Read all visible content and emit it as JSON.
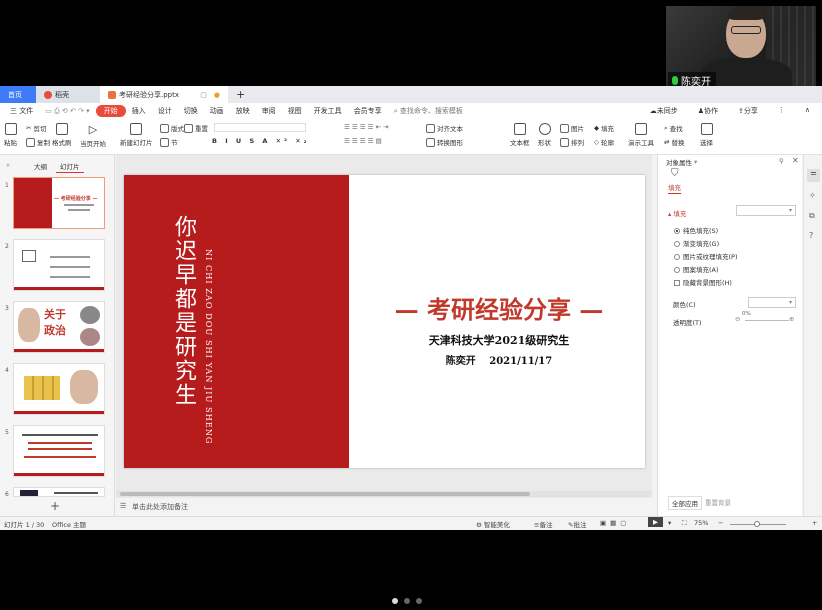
{
  "video": {
    "participant_name": "陈奕开"
  },
  "tabs": [
    {
      "label": "首页"
    },
    {
      "label": "稻壳"
    },
    {
      "label": "考研经验分享.pptx"
    }
  ],
  "menu": {
    "file": "三 文件",
    "items": [
      "开始",
      "插入",
      "设计",
      "切换",
      "动画",
      "放映",
      "审阅",
      "视图",
      "开发工具",
      "会员专享"
    ],
    "search_placeholder": "查找命令、搜索模板",
    "right": [
      "未同步",
      "协作",
      "分享"
    ]
  },
  "ribbon": {
    "paste": "粘贴",
    "cut": "剪切",
    "copy": "复制",
    "format_painter": "格式刷",
    "from_current": "当页开始",
    "new_slide": "新建幻灯片",
    "layout": "版式",
    "section": "节",
    "reset": "重置",
    "align_text": "对齐文本",
    "convert_smartart": "转换图形",
    "textbox": "文本框",
    "shape": "形状",
    "arrange": "排列",
    "picture": "图片",
    "fill": "填充",
    "outline": "轮廓",
    "presenter_tools": "演示工具",
    "find": "查找",
    "replace": "替换",
    "select": "选择"
  },
  "left_pane": {
    "tabs": [
      "大纲",
      "幻灯片"
    ],
    "slide_numbers": [
      "1",
      "2",
      "3",
      "4",
      "5",
      "6"
    ],
    "thumb3_title": "关于",
    "thumb3_sub": "政治",
    "thumb1_title": "— 考研经验分享 —"
  },
  "slide": {
    "vertical_title": "你迟早都是研究生",
    "vertical_pinyin": "NI CHI ZAO DOU SHI YAN JIU SHENG",
    "title": "— 考研经验分享 —",
    "subtitle": "天津科技大学2021级研究生",
    "author_date": "陈奕开 2021/11/17"
  },
  "right_pane": {
    "header": "对象属性",
    "tab_fill": "填充",
    "section_fill": "填充",
    "options": [
      {
        "label": "纯色填充(S)",
        "selected": true
      },
      {
        "label": "渐变填充(G)",
        "selected": false
      },
      {
        "label": "图片或纹理填充(P)",
        "selected": false
      },
      {
        "label": "图案填充(A)",
        "selected": false
      }
    ],
    "hide_bg": "隐藏背景图形(H)",
    "color_label": "颜色(C)",
    "transparency_label": "透明度(T)",
    "transparency_value": "0%",
    "apply_all": "全部应用",
    "reset_bg": "重置背景"
  },
  "notes": {
    "placeholder": "单击此处添加备注"
  },
  "status": {
    "slide_counter": "幻灯片 1 / 30",
    "theme": "Office 主题",
    "smart_beautify": "智能美化",
    "notes": "备注",
    "comments": "批注",
    "zoom": "75%"
  },
  "colors": {
    "accent": "#e94b3c",
    "slide_red": "#b71c1c",
    "title_red": "#c0392b",
    "tab_blue": "#3d7bf7"
  }
}
